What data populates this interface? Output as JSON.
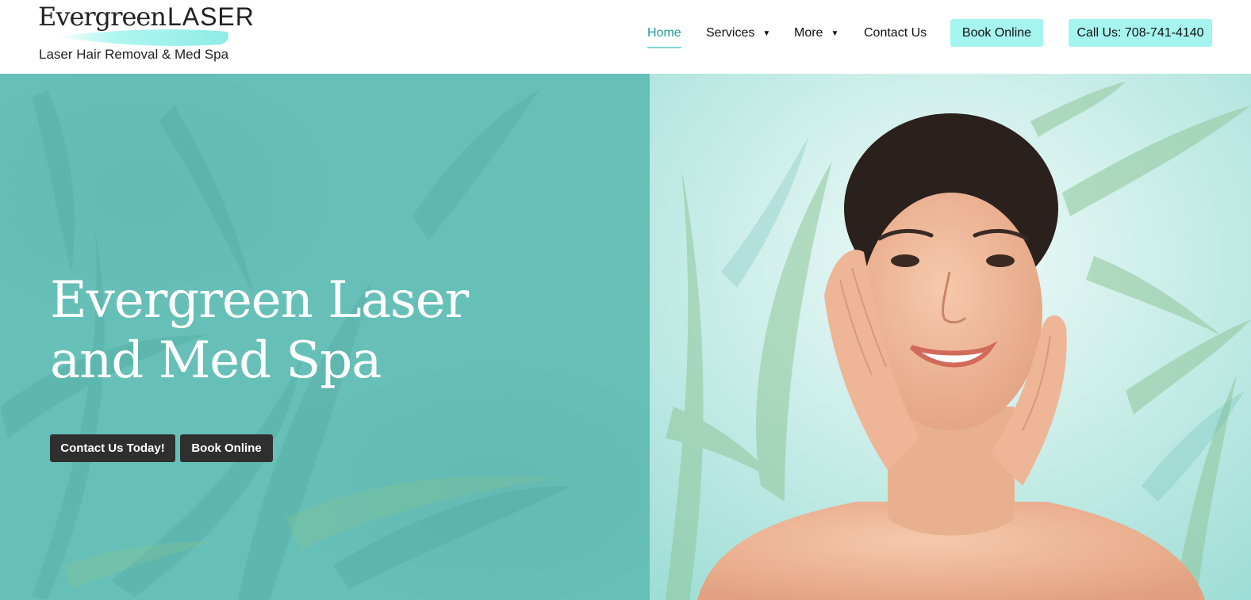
{
  "logo": {
    "brand_word_1": "Evergreen",
    "brand_word_2": "LASER",
    "tagline": "Laser Hair Removal & Med Spa"
  },
  "nav": {
    "items": [
      {
        "label": "Home",
        "active": true,
        "has_dropdown": false
      },
      {
        "label": "Services",
        "active": false,
        "has_dropdown": true
      },
      {
        "label": "More",
        "active": false,
        "has_dropdown": true
      },
      {
        "label": "Contact Us",
        "active": false,
        "has_dropdown": false
      }
    ],
    "dropdown_glyph": "▼",
    "book_online": "Book Online",
    "call_us": "Call Us: 708-741-4140"
  },
  "hero": {
    "title_line_1": "Evergreen Laser",
    "title_line_2": "and Med Spa",
    "cta_contact": "Contact Us Today!",
    "cta_book": "Book Online",
    "photo_subject": "smiling woman with hands on face, bamboo leaves background"
  },
  "colors": {
    "accent_teal": "#67c0b8",
    "nav_active": "#1f9a98",
    "pill_bg": "#a6f4ef",
    "cta_bg": "#2f2f2f",
    "text_dark": "#111111"
  },
  "icons": {
    "dropdown": "caret-down-icon"
  }
}
